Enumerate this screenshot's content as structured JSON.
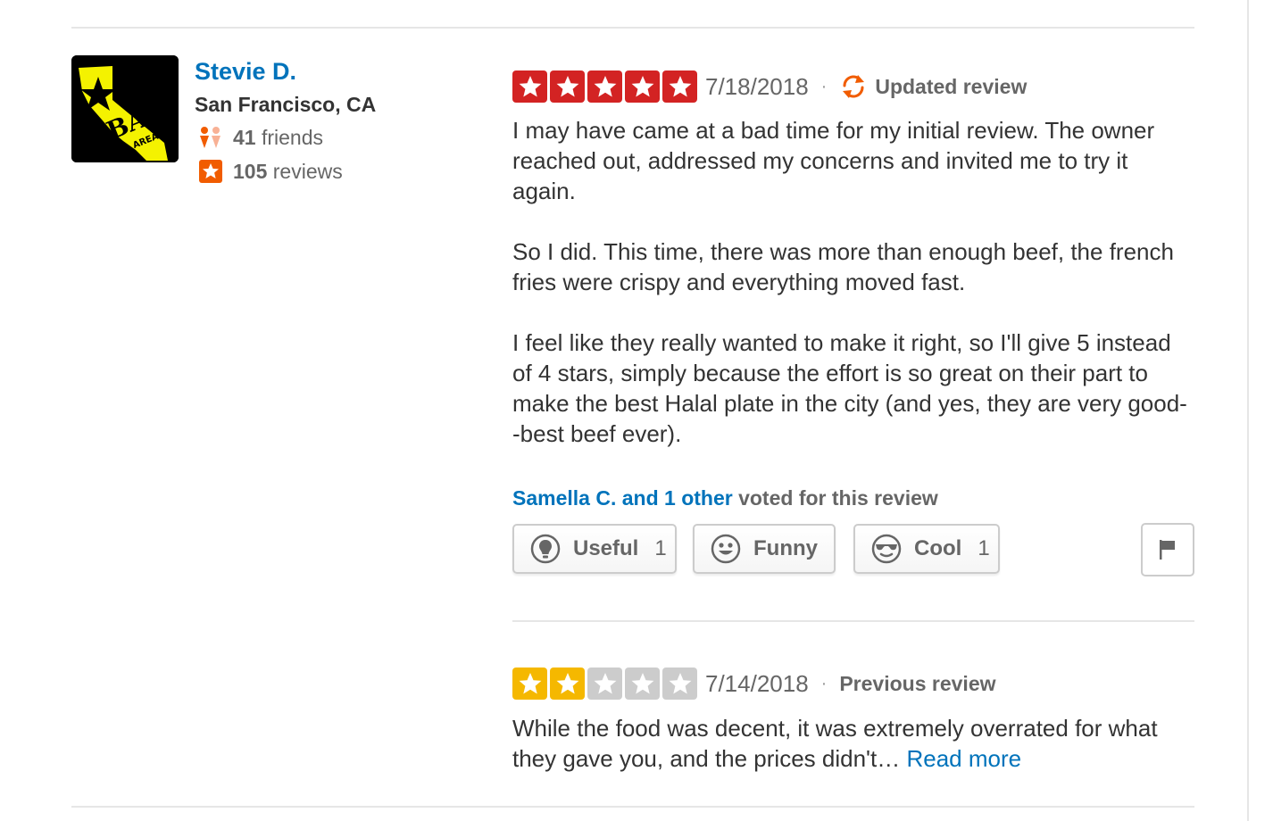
{
  "user": {
    "name": "Stevie D.",
    "location": "San Francisco, CA",
    "friends_count": "41",
    "friends_label": "friends",
    "reviews_count": "105",
    "reviews_label": "reviews",
    "avatar_text": "BAY AREA"
  },
  "colors": {
    "link": "#0073bb",
    "star_full": "#d32323",
    "star_old": "#f5b800",
    "star_empty": "#cccccc",
    "update_icon": "#f15c00",
    "avatar_yellow": "#f4f200"
  },
  "current_review": {
    "rating": 5,
    "date": "7/18/2018",
    "separator": "·",
    "status_label": "Updated review",
    "paragraphs": [
      "I may have came at a bad time for my initial review. The owner reached out, addressed my concerns and invited me to try it again.",
      "So I did. This time, there was more than enough beef, the french fries were crispy and everything moved fast.",
      "I feel like they really wanted to make it right, so I'll give 5 instead of 4 stars, simply because the effort is so great on their part to make the best Halal plate in the city (and yes, they are very good--best beef ever)."
    ],
    "voters_link": "Samella C. and 1 other",
    "voters_suffix": " voted for this review",
    "votes": {
      "useful_label": "Useful",
      "useful_count": "1",
      "funny_label": "Funny",
      "funny_count": "",
      "cool_label": "Cool",
      "cool_count": "1"
    }
  },
  "previous_review": {
    "rating": 2,
    "date": "7/14/2018",
    "separator": "·",
    "status_label": "Previous review",
    "excerpt": "While the food was decent, it was extremely overrated for what they gave you, and the prices didn't…",
    "read_more_label": "Read more"
  }
}
